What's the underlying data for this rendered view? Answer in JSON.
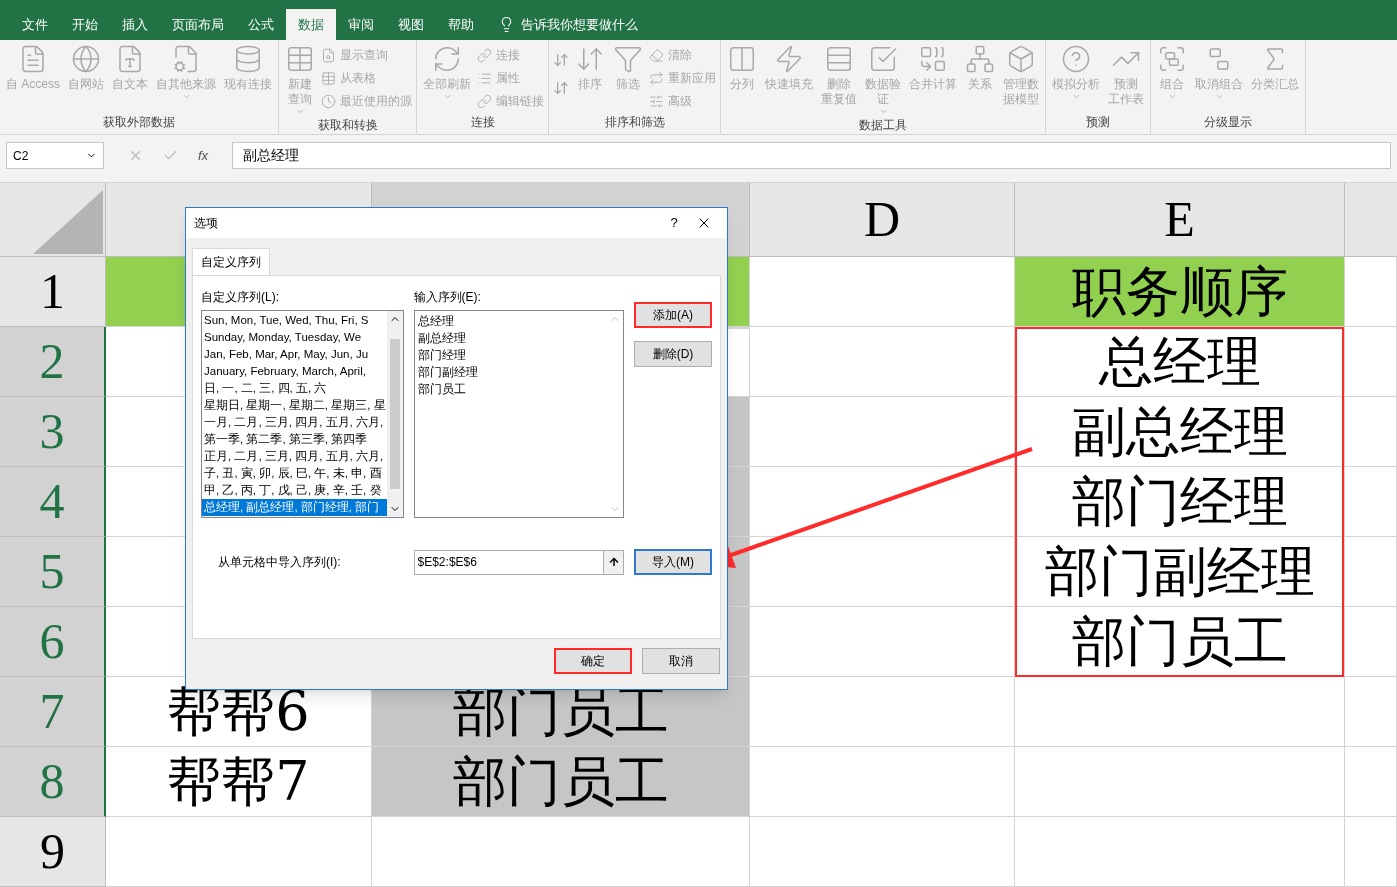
{
  "ribbon_tabs": [
    {
      "label": "文件",
      "selected": false
    },
    {
      "label": "开始",
      "selected": false
    },
    {
      "label": "插入",
      "selected": false
    },
    {
      "label": "页面布局",
      "selected": false
    },
    {
      "label": "公式",
      "selected": false
    },
    {
      "label": "数据",
      "selected": true
    },
    {
      "label": "审阅",
      "selected": false
    },
    {
      "label": "视图",
      "selected": false
    },
    {
      "label": "帮助",
      "selected": false
    }
  ],
  "tell_me": "告诉我你想要做什么",
  "ribbon_groups": [
    {
      "label": "获取外部数据",
      "items": [
        {
          "kind": "large",
          "label": "自 Access"
        },
        {
          "kind": "large",
          "label": "自网站"
        },
        {
          "kind": "large",
          "label": "自文本"
        },
        {
          "kind": "large",
          "label": "自其他来源",
          "dropdown": true
        },
        {
          "kind": "large",
          "label": "现有连接"
        }
      ]
    },
    {
      "label": "获取和转换",
      "items": [
        {
          "kind": "large",
          "lines": [
            "新建",
            "查询"
          ],
          "dropdown": true
        },
        {
          "kind": "stack",
          "items": [
            "显示查询",
            "从表格",
            "最近使用的源"
          ]
        }
      ]
    },
    {
      "label": "连接",
      "items": [
        {
          "kind": "large",
          "label": "全部刷新",
          "dropdown": true
        },
        {
          "kind": "stack",
          "items": [
            "连接",
            "属性",
            "编辑链接"
          ]
        }
      ]
    },
    {
      "label": "排序和筛选",
      "items": [
        {
          "kind": "sort"
        },
        {
          "kind": "large",
          "label": "排序"
        },
        {
          "kind": "large",
          "label": "筛选"
        },
        {
          "kind": "stack",
          "items": [
            "清除",
            "重新应用",
            "高级"
          ]
        }
      ]
    },
    {
      "label": "数据工具",
      "items": [
        {
          "kind": "large",
          "label": "分列"
        },
        {
          "kind": "large",
          "label": "快速填充"
        },
        {
          "kind": "large",
          "lines": [
            "删除",
            "重复值"
          ]
        },
        {
          "kind": "large",
          "lines": [
            "数据验",
            "证"
          ],
          "dropdown": true
        },
        {
          "kind": "large",
          "label": "合并计算"
        },
        {
          "kind": "large",
          "label": "关系"
        },
        {
          "kind": "large",
          "lines": [
            "管理数",
            "据模型"
          ]
        }
      ]
    },
    {
      "label": "预测",
      "items": [
        {
          "kind": "large",
          "label": "模拟分析",
          "dropdown": true
        },
        {
          "kind": "large",
          "lines": [
            "预测",
            "工作表"
          ]
        }
      ]
    },
    {
      "label": "分级显示",
      "items": [
        {
          "kind": "large",
          "label": "组合",
          "dropdown": true
        },
        {
          "kind": "large",
          "label": "取消组合",
          "dropdown": true
        },
        {
          "kind": "large",
          "label": "分类汇总"
        }
      ]
    }
  ],
  "name_box": "C2",
  "function_label": "fx",
  "formula": "副总经理",
  "columns": [
    {
      "label": "D",
      "selected": false
    },
    {
      "label": "E",
      "selected": false
    }
  ],
  "hidden_columns": [
    {
      "selected": false
    },
    {
      "selected": true
    }
  ],
  "rows": [
    {
      "header": "1",
      "selected": false,
      "cells": [
        {
          "color": "#92d050"
        },
        {
          "color": "#92d050"
        },
        {},
        {
          "text": "职务顺序",
          "color": "#92d050"
        },
        {}
      ]
    },
    {
      "header": "2",
      "selected": true,
      "cells": [
        {},
        {
          "active": true
        },
        {},
        {
          "text": "总经理"
        },
        {}
      ]
    },
    {
      "header": "3",
      "selected": true,
      "cells": [
        {},
        {
          "selected": true
        },
        {},
        {
          "text": "副总经理"
        },
        {}
      ]
    },
    {
      "header": "4",
      "selected": true,
      "cells": [
        {},
        {
          "selected": true
        },
        {},
        {
          "text": "部门经理"
        },
        {}
      ]
    },
    {
      "header": "5",
      "selected": true,
      "cells": [
        {},
        {
          "selected": true
        },
        {},
        {
          "text": "部门副经理"
        },
        {}
      ]
    },
    {
      "header": "6",
      "selected": true,
      "cells": [
        {},
        {
          "selected": true
        },
        {},
        {
          "text": "部门员工"
        },
        {}
      ]
    },
    {
      "header": "7",
      "selected": true,
      "cells": [
        {
          "text": "帮帮6"
        },
        {
          "text": "部门员工",
          "selected": true
        },
        {},
        {},
        {}
      ]
    },
    {
      "header": "8",
      "selected": true,
      "cells": [
        {
          "text": "帮帮7"
        },
        {
          "text": "部门员工",
          "selected": true
        },
        {},
        {},
        {}
      ]
    },
    {
      "header": "9",
      "selected": false,
      "cells": [
        {},
        {},
        {},
        {},
        {}
      ]
    }
  ],
  "dialog": {
    "title": "选项",
    "help": "?",
    "tab": "自定义序列",
    "lists_label": "自定义序列(L):",
    "lists": [
      {
        "text": "Sun, Mon, Tue, Wed, Thu, Fri, S",
        "selected": false
      },
      {
        "text": "Sunday, Monday, Tuesday, We",
        "selected": false
      },
      {
        "text": "Jan, Feb, Mar, Apr, May, Jun, Ju",
        "selected": false
      },
      {
        "text": "January, February, March, April,",
        "selected": false
      },
      {
        "text": "日, 一, 二, 三, 四, 五, 六",
        "selected": false
      },
      {
        "text": "星期日, 星期一, 星期二, 星期三, 星",
        "selected": false
      },
      {
        "text": "一月, 二月, 三月, 四月, 五月, 六月,",
        "selected": false
      },
      {
        "text": "第一季, 第二季, 第三季, 第四季",
        "selected": false
      },
      {
        "text": "正月, 二月, 三月, 四月, 五月, 六月,",
        "selected": false
      },
      {
        "text": "子, 丑, 寅, 卯, 辰, 巳, 午, 未, 申, 酉",
        "selected": false
      },
      {
        "text": "甲, 乙, 丙, 丁, 戊, 己, 庚, 辛, 壬, 癸",
        "selected": false
      },
      {
        "text": "总经理, 副总经理, 部门经理, 部门",
        "selected": true
      }
    ],
    "entries_label": "输入序列(E):",
    "entries": [
      "总经理",
      "副总经理",
      "部门经理",
      "部门副经理",
      "部门员工"
    ],
    "add_button": {
      "label": "添加(A)",
      "highlighted": true
    },
    "delete_button": {
      "label": "删除(D)",
      "highlighted": false
    },
    "import_label": "从单元格中导入序列(I):",
    "import_value": "$E$2:$E$6",
    "import_button": {
      "label": "导入(M)",
      "focused": true
    },
    "ok_button": {
      "label": "确定",
      "highlighted": true
    },
    "cancel_button": {
      "label": "取消",
      "highlighted": false
    }
  }
}
